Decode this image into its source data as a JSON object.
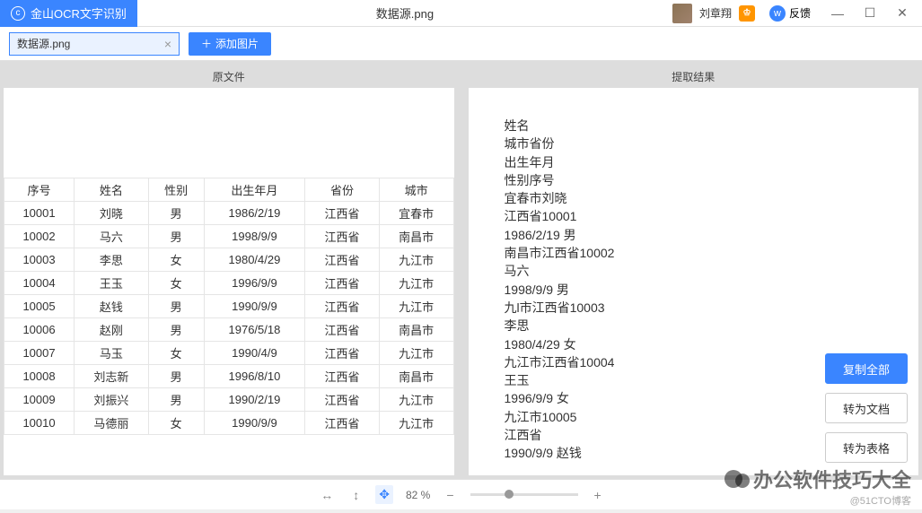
{
  "title": {
    "app": "金山OCR文字识别",
    "file": "数据源.png"
  },
  "user": {
    "name": "刘章翔",
    "vip": "♔"
  },
  "feedback": "反馈",
  "toolbar": {
    "filename": "数据源.png",
    "add": "添加图片"
  },
  "panels": {
    "left": "原文件",
    "right": "提取结果"
  },
  "table": {
    "headers": [
      "序号",
      "姓名",
      "性别",
      "出生年月",
      "省份",
      "城市"
    ],
    "rows": [
      [
        "10001",
        "刘晓",
        "男",
        "1986/2/19",
        "江西省",
        "宜春市"
      ],
      [
        "10002",
        "马六",
        "男",
        "1998/9/9",
        "江西省",
        "南昌市"
      ],
      [
        "10003",
        "李思",
        "女",
        "1980/4/29",
        "江西省",
        "九江市"
      ],
      [
        "10004",
        "王玉",
        "女",
        "1996/9/9",
        "江西省",
        "九江市"
      ],
      [
        "10005",
        "赵钱",
        "男",
        "1990/9/9",
        "江西省",
        "九江市"
      ],
      [
        "10006",
        "赵刚",
        "男",
        "1976/5/18",
        "江西省",
        "南昌市"
      ],
      [
        "10007",
        "马玉",
        "女",
        "1990/4/9",
        "江西省",
        "九江市"
      ],
      [
        "10008",
        "刘志新",
        "男",
        "1996/8/10",
        "江西省",
        "南昌市"
      ],
      [
        "10009",
        "刘振兴",
        "男",
        "1990/2/19",
        "江西省",
        "九江市"
      ],
      [
        "10010",
        "马德丽",
        "女",
        "1990/9/9",
        "江西省",
        "九江市"
      ]
    ]
  },
  "extracted": "姓名\n城市省份\n出生年月\n性别序号\n宜春市刘晓\n江西省10001\n1986/2/19 男\n南昌市江西省10002\n马六\n1998/9/9 男\n九l市江西省10003\n李思\n1980/4/29 女\n九江市江西省10004\n王玉\n1996/9/9 女\n九江市10005\n江西省\n1990/9/9 赵钱",
  "actions": {
    "copy": "复制全部",
    "doc": "转为文档",
    "sheet": "转为表格"
  },
  "status": {
    "zoom": "82 %"
  },
  "watermark": {
    "line1": "办公软件技巧大全",
    "line2": "@51CTO博客"
  }
}
